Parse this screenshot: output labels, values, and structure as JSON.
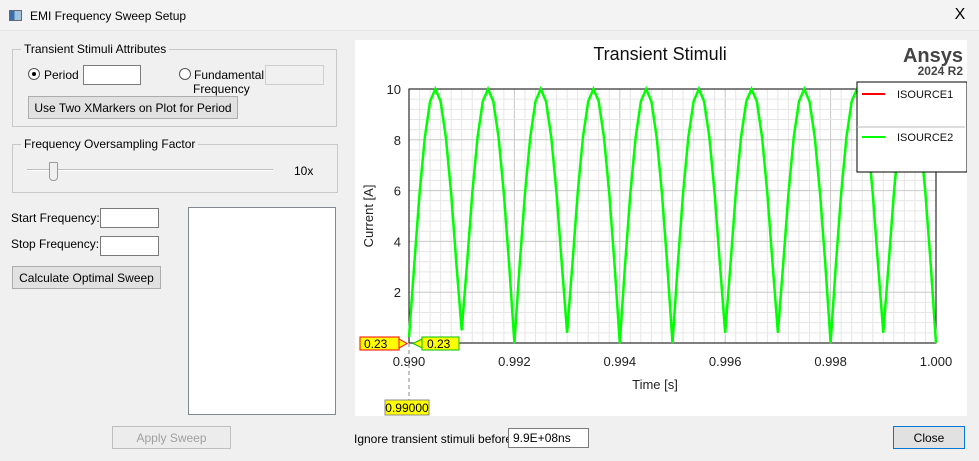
{
  "window": {
    "title": "EMI Frequency Sweep Setup",
    "close_label": "X"
  },
  "transient_attributes": {
    "group_label": "Transient Stimuli Attributes",
    "period_label": "Period",
    "period_value": "",
    "period_selected": true,
    "fundamental_label_1": "Fundamental",
    "fundamental_label_2": "Frequency",
    "fundamental_value": "",
    "fundamental_selected": false,
    "xmarkers_button": "Use Two XMarkers on Plot for Period"
  },
  "oversampling": {
    "group_label": "Frequency Oversampling Factor",
    "value_label": "10x",
    "slider_fraction": 0.1
  },
  "sweep": {
    "start_label": "Start Frequency:",
    "start_value": "",
    "stop_label": "Stop Frequency:",
    "stop_value": "",
    "calculate_button": "Calculate Optimal Sweep",
    "apply_button": "Apply Sweep"
  },
  "footer": {
    "ignore_label": "Ignore transient stimuli before",
    "ignore_value": "9.9E+08ns",
    "close_button": "Close"
  },
  "chart_data": {
    "type": "line",
    "title": "Transient Stimuli",
    "brand": "Ansys",
    "brand_sub": "2024 R2",
    "xlabel": "Time [s]",
    "ylabel": "Current [A]",
    "xlim": [
      0.99,
      1.0
    ],
    "ylim": [
      0,
      10
    ],
    "xticks": [
      "0.990",
      "0.992",
      "0.994",
      "0.996",
      "0.998",
      "1.000"
    ],
    "yticks": [
      "0",
      "2",
      "4",
      "6",
      "8",
      "10"
    ],
    "grid": true,
    "legend_placement": "top-right",
    "markers": {
      "x_marker": "0.99000",
      "y_marker_isource1": "0.23",
      "y_marker_isource2": "0.23"
    },
    "series": [
      {
        "name": "ISOURCE1",
        "color": "#ff0000",
        "x": [],
        "y": []
      },
      {
        "name": "ISOURCE2",
        "color": "#00ff00",
        "x": [
          0.99,
          0.9901,
          0.9902,
          0.9903,
          0.9904,
          0.9905,
          0.9906,
          0.9907,
          0.9908,
          0.9909,
          0.991,
          0.9911,
          0.9912,
          0.9913,
          0.9914,
          0.9915,
          0.9916,
          0.9917,
          0.9918,
          0.9919,
          0.992,
          0.9921,
          0.9922,
          0.9923,
          0.9924,
          0.9925,
          0.9926,
          0.9927,
          0.9928,
          0.9929,
          0.993,
          0.9931,
          0.9932,
          0.9933,
          0.9934,
          0.9935,
          0.9936,
          0.9937,
          0.9938,
          0.9939,
          0.994,
          0.9941,
          0.9942,
          0.9943,
          0.9944,
          0.9945,
          0.9946,
          0.9947,
          0.9948,
          0.9949,
          0.995,
          0.9951,
          0.9952,
          0.9953,
          0.9954,
          0.9955,
          0.9956,
          0.9957,
          0.9958,
          0.9959,
          0.996,
          0.9961,
          0.9962,
          0.9963,
          0.9964,
          0.9965,
          0.9966,
          0.9967,
          0.9968,
          0.9969,
          0.997,
          0.9971,
          0.9972,
          0.9973,
          0.9974,
          0.9975,
          0.9976,
          0.9977,
          0.9978,
          0.9979,
          0.998,
          0.9981,
          0.9982,
          0.9983,
          0.9984,
          0.9985,
          0.9986,
          0.9987,
          0.9988,
          0.9989,
          0.999,
          0.9991,
          0.9992,
          0.9993,
          0.9994,
          0.9995,
          0.9996,
          0.9997,
          0.9998,
          0.9999,
          1.0
        ],
        "y": [
          0.23,
          3.09,
          5.88,
          8.09,
          9.51,
          10,
          9.51,
          8.09,
          5.88,
          3.09,
          0.5,
          3.09,
          5.88,
          8.09,
          9.51,
          10,
          9.51,
          8.09,
          5.88,
          3.09,
          0,
          3.09,
          5.88,
          8.09,
          9.51,
          10,
          9.51,
          8.09,
          5.88,
          3.09,
          0.4,
          3.09,
          5.88,
          8.09,
          9.51,
          10,
          9.51,
          8.09,
          5.88,
          3.09,
          0,
          3.09,
          5.88,
          8.09,
          9.51,
          10,
          9.51,
          8.09,
          5.88,
          3.09,
          0,
          3.09,
          5.88,
          8.09,
          9.51,
          10,
          9.51,
          8.09,
          5.88,
          3.09,
          0.4,
          3.09,
          5.88,
          8.09,
          9.51,
          10,
          9.51,
          8.09,
          5.88,
          3.09,
          0.4,
          3.09,
          5.88,
          8.09,
          9.51,
          10,
          9.51,
          8.09,
          5.88,
          3.09,
          0,
          3.09,
          5.88,
          8.09,
          9.51,
          10,
          9.51,
          8.09,
          5.88,
          3.09,
          0.4,
          3.09,
          5.88,
          8.09,
          9.51,
          10,
          9.51,
          8.09,
          5.88,
          3.09,
          0
        ]
      }
    ]
  }
}
